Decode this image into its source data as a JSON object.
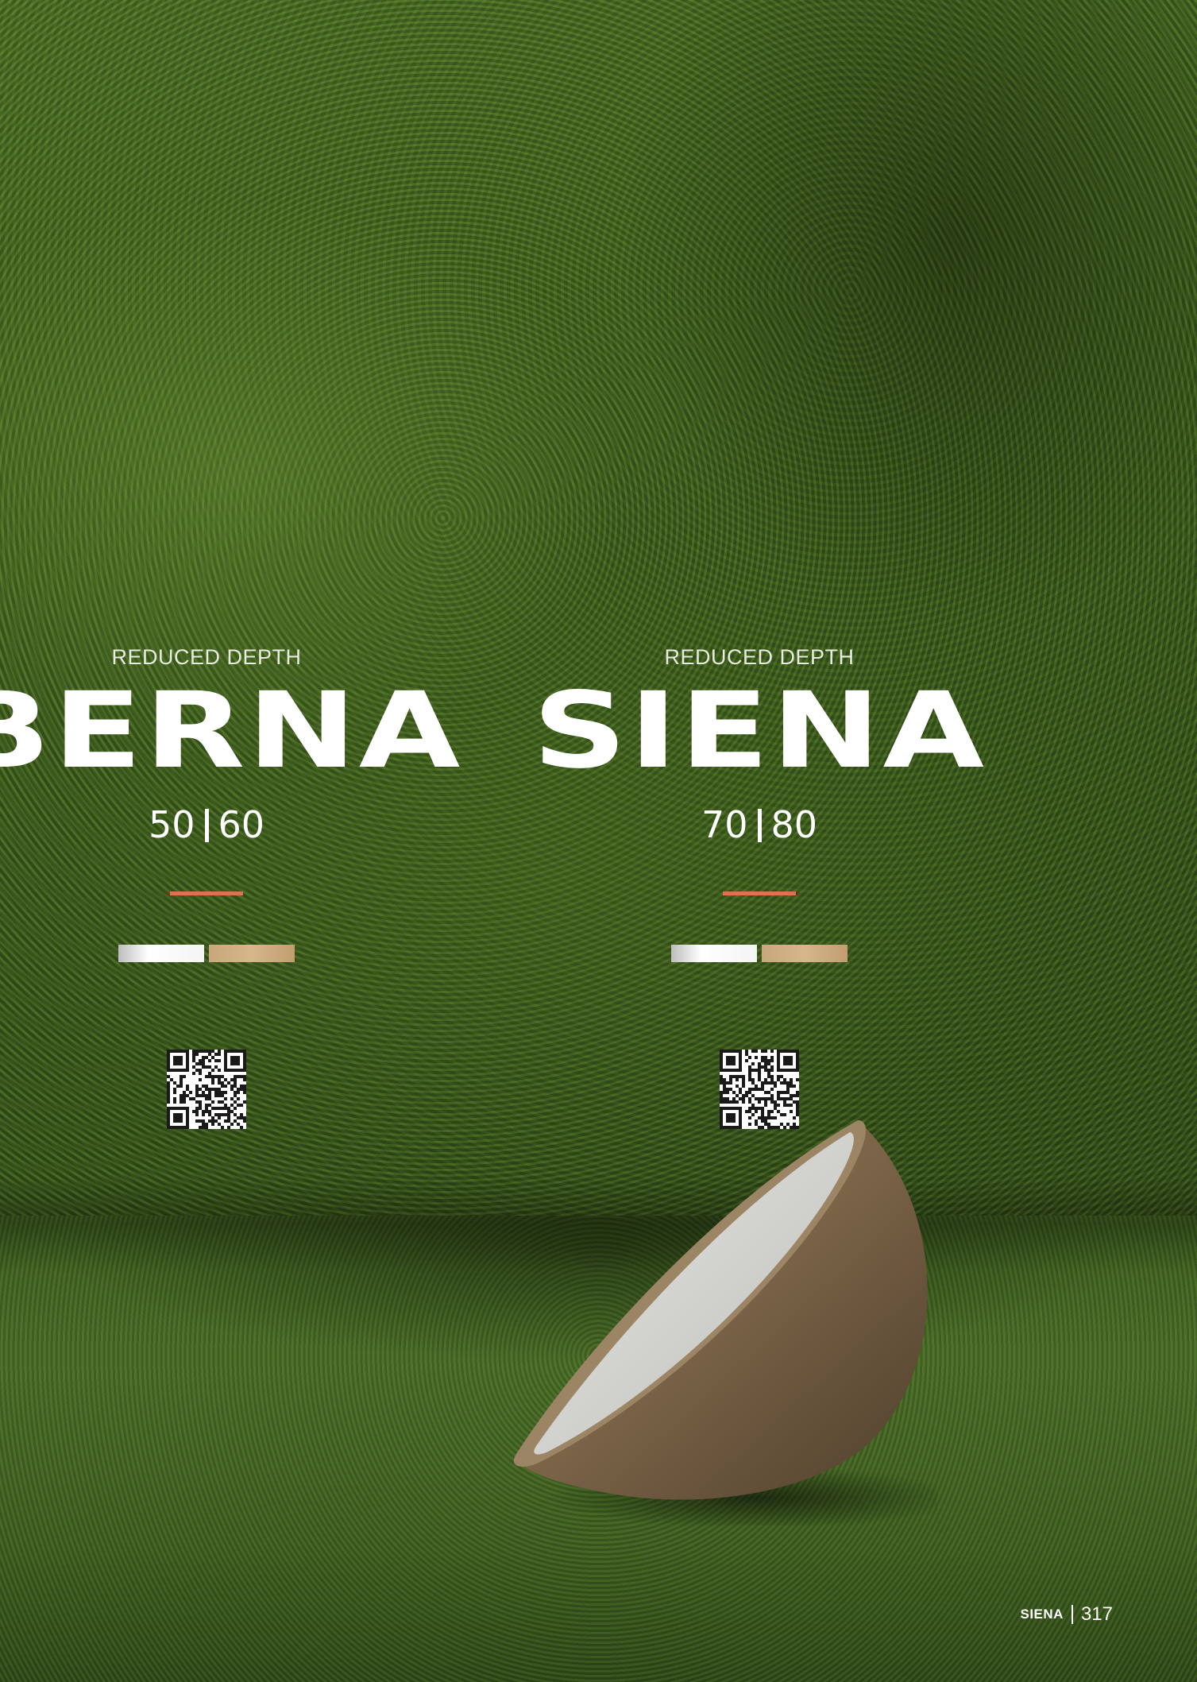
{
  "products": [
    {
      "subtitle": "REDUCED DEPTH",
      "name": "BERNA",
      "size_1": "50",
      "size_2": "60",
      "accent_color": "#d9744e",
      "finishes": [
        "white",
        "wood"
      ],
      "qr": "qr-code-icon"
    },
    {
      "subtitle": "REDUCED DEPTH",
      "name": "SIENA",
      "size_1": "70",
      "size_2": "80",
      "accent_color": "#d9744e",
      "finishes": [
        "white",
        "wood"
      ],
      "qr": "qr-code-icon"
    }
  ],
  "footer": {
    "collection": "SIENA",
    "page_number": "317"
  },
  "colors": {
    "accent": "#d9744e",
    "finish_white": "#ffffff",
    "finish_wood": "#d6b68b",
    "text": "#ffffff"
  }
}
